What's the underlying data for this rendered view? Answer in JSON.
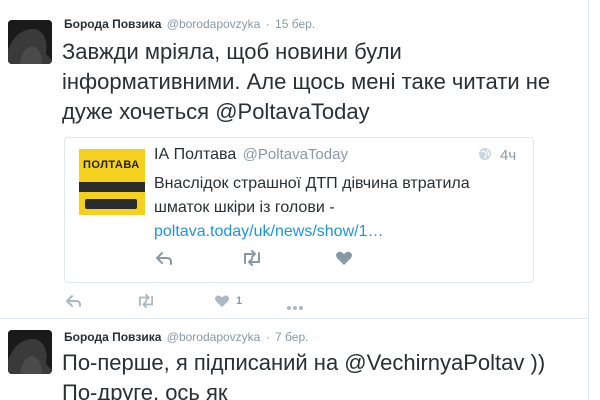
{
  "tweets": [
    {
      "fullname": "Борода Повзика",
      "username": "@borodapovzyka",
      "time": "15 бер.",
      "text_main": "Завжди мріяла, щоб новини були інформативними. Але щось мені таке читати не дуже хочеться ",
      "mention": "@PoltavaToday",
      "quote": {
        "logo_text": "ПОЛТАВА",
        "name": "ІА Полтава",
        "username": "@PoltavaToday",
        "time": "4ч",
        "text": "Внаслідок страшної ДТП дівчина втратила шматок шкіри із голови -",
        "link": "poltava.today/uk/news/show/1…"
      },
      "like_count": "1",
      "icons": [
        "reply-icon",
        "retweet-icon",
        "like-icon",
        "more-icon"
      ]
    },
    {
      "fullname": "Борода Повзика",
      "username": "@borodapovzyka",
      "time": "7 бер.",
      "text": "По-перше, я підписаний на @VechirnyaPoltav )) По-друге, ось як"
    }
  ],
  "colors": {
    "text": "#292f33",
    "muted": "#8899a6",
    "link": "#1b95e0",
    "border": "#e1e8ed",
    "logo_yellow": "#f4d01f"
  }
}
